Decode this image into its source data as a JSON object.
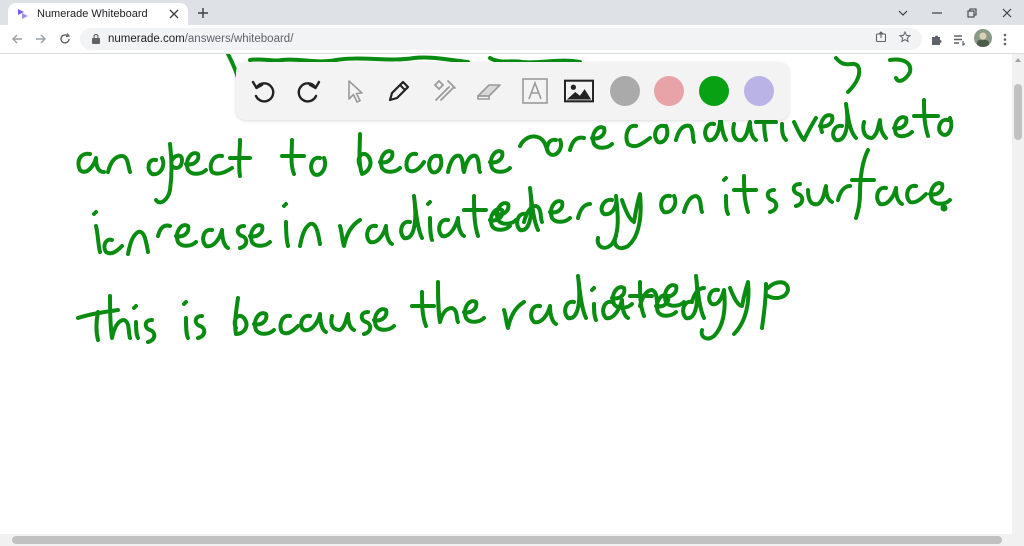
{
  "browser": {
    "tab_title": "Numerade Whiteboard",
    "url_host": "numerade.com",
    "url_path": "/answers/whiteboard/"
  },
  "icons": {
    "favicon": "numerade-logo-icon",
    "tab_close": "close-icon",
    "new_tab": "plus-icon",
    "back": "arrow-left-icon",
    "forward": "arrow-right-icon",
    "reload": "reload-icon",
    "lock": "lock-icon",
    "share": "share-icon",
    "bookmark": "star-icon",
    "extensions": "puzzle-icon",
    "reading_list": "reading-list-icon",
    "profile": "avatar-icon",
    "minimize": "minimize-icon",
    "maximize": "restore-icon",
    "close_window": "close-icon"
  },
  "whiteboard": {
    "tools": [
      "undo",
      "redo",
      "select",
      "pen",
      "tools",
      "eraser",
      "text",
      "image"
    ],
    "colors": [
      "#aaaaaa",
      "#e8a3a8",
      "#07a113",
      "#b9b3e6"
    ],
    "ink_color": "#0a8c12",
    "selected_color": "#07a113"
  }
}
